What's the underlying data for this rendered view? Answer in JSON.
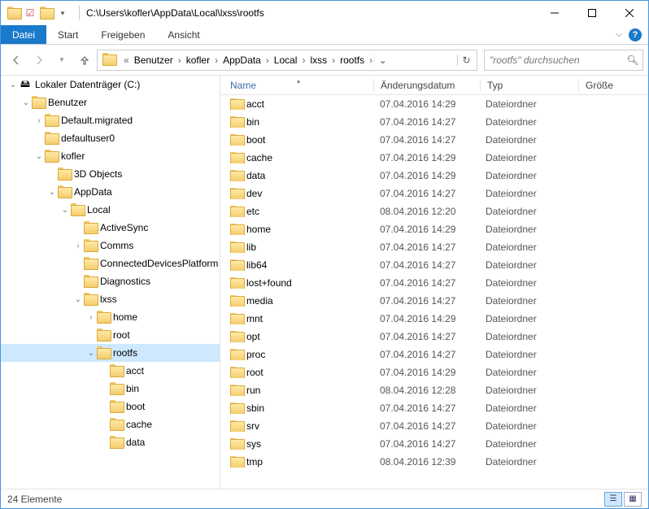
{
  "title_path": "C:\\Users\\kofler\\AppData\\Local\\lxss\\rootfs",
  "ribbon": {
    "file": "Datei",
    "start": "Start",
    "share": "Freigeben",
    "view": "Ansicht"
  },
  "breadcrumbs": [
    "Benutzer",
    "kofler",
    "AppData",
    "Local",
    "lxss",
    "rootfs"
  ],
  "search_placeholder": "\"rootfs\" durchsuchen",
  "columns": {
    "name": "Name",
    "date": "Änderungsdatum",
    "type": "Typ",
    "size": "Größe"
  },
  "tree": [
    {
      "indent": 0,
      "label": "Lokaler Datenträger (C:)",
      "exp": "open",
      "icon": "drive"
    },
    {
      "indent": 1,
      "label": "Benutzer",
      "exp": "open"
    },
    {
      "indent": 2,
      "label": "Default.migrated",
      "exp": "closed"
    },
    {
      "indent": 2,
      "label": "defaultuser0",
      "exp": "none"
    },
    {
      "indent": 2,
      "label": "kofler",
      "exp": "open"
    },
    {
      "indent": 3,
      "label": "3D Objects",
      "exp": "none"
    },
    {
      "indent": 3,
      "label": "AppData",
      "exp": "open"
    },
    {
      "indent": 4,
      "label": "Local",
      "exp": "open"
    },
    {
      "indent": 5,
      "label": "ActiveSync",
      "exp": "none"
    },
    {
      "indent": 5,
      "label": "Comms",
      "exp": "closed"
    },
    {
      "indent": 5,
      "label": "ConnectedDevicesPlatform",
      "exp": "none"
    },
    {
      "indent": 5,
      "label": "Diagnostics",
      "exp": "none"
    },
    {
      "indent": 5,
      "label": "lxss",
      "exp": "open"
    },
    {
      "indent": 6,
      "label": "home",
      "exp": "closed"
    },
    {
      "indent": 6,
      "label": "root",
      "exp": "none"
    },
    {
      "indent": 6,
      "label": "rootfs",
      "exp": "open",
      "selected": true
    },
    {
      "indent": 7,
      "label": "acct",
      "exp": "none"
    },
    {
      "indent": 7,
      "label": "bin",
      "exp": "none"
    },
    {
      "indent": 7,
      "label": "boot",
      "exp": "none"
    },
    {
      "indent": 7,
      "label": "cache",
      "exp": "none"
    },
    {
      "indent": 7,
      "label": "data",
      "exp": "none"
    }
  ],
  "type_folder": "Dateiordner",
  "items": [
    {
      "name": "acct",
      "date": "07.04.2016 14:29"
    },
    {
      "name": "bin",
      "date": "07.04.2016 14:27"
    },
    {
      "name": "boot",
      "date": "07.04.2016 14:27"
    },
    {
      "name": "cache",
      "date": "07.04.2016 14:29"
    },
    {
      "name": "data",
      "date": "07.04.2016 14:29"
    },
    {
      "name": "dev",
      "date": "07.04.2016 14:27"
    },
    {
      "name": "etc",
      "date": "08.04.2016 12:20"
    },
    {
      "name": "home",
      "date": "07.04.2016 14:29"
    },
    {
      "name": "lib",
      "date": "07.04.2016 14:27"
    },
    {
      "name": "lib64",
      "date": "07.04.2016 14:27"
    },
    {
      "name": "lost+found",
      "date": "07.04.2016 14:27"
    },
    {
      "name": "media",
      "date": "07.04.2016 14:27"
    },
    {
      "name": "mnt",
      "date": "07.04.2016 14:29"
    },
    {
      "name": "opt",
      "date": "07.04.2016 14:27"
    },
    {
      "name": "proc",
      "date": "07.04.2016 14:27"
    },
    {
      "name": "root",
      "date": "07.04.2016 14:29"
    },
    {
      "name": "run",
      "date": "08.04.2016 12:28"
    },
    {
      "name": "sbin",
      "date": "07.04.2016 14:27"
    },
    {
      "name": "srv",
      "date": "07.04.2016 14:27"
    },
    {
      "name": "sys",
      "date": "07.04.2016 14:27"
    },
    {
      "name": "tmp",
      "date": "08.04.2016 12:39"
    }
  ],
  "status_text": "24 Elemente"
}
